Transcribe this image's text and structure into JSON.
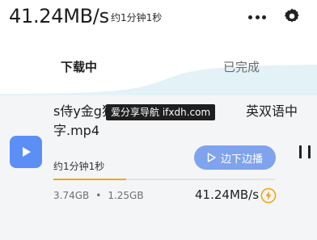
{
  "header": {
    "speed": "41.24MB/s",
    "eta": "约1分钟1秒"
  },
  "tabs": [
    {
      "label": "下载中",
      "active": true
    },
    {
      "label": "已完成",
      "active": false
    }
  ],
  "task": {
    "name_line1": "s侍y金g狠",
    "name_line1_tail": "英双语中",
    "name_line2": "字.mp4",
    "watermark": "爱分享导航  ifxdh.com",
    "eta": "约1分钟1秒",
    "play_label": "边下边播",
    "progress": 0.33,
    "downloaded": "3.74GB",
    "total": "1.25GB",
    "separator": "•",
    "speed": "41.24MB/s"
  },
  "colors": {
    "accent": "#5b8ff5",
    "play_button": "#7fa3ec",
    "progress": "#f0a71a",
    "tab_wave": "#e3f2f6"
  },
  "icons": [
    "more-icon",
    "gear-icon",
    "video-play-icon",
    "play-outline-icon",
    "pause-icon",
    "bolt-icon"
  ]
}
